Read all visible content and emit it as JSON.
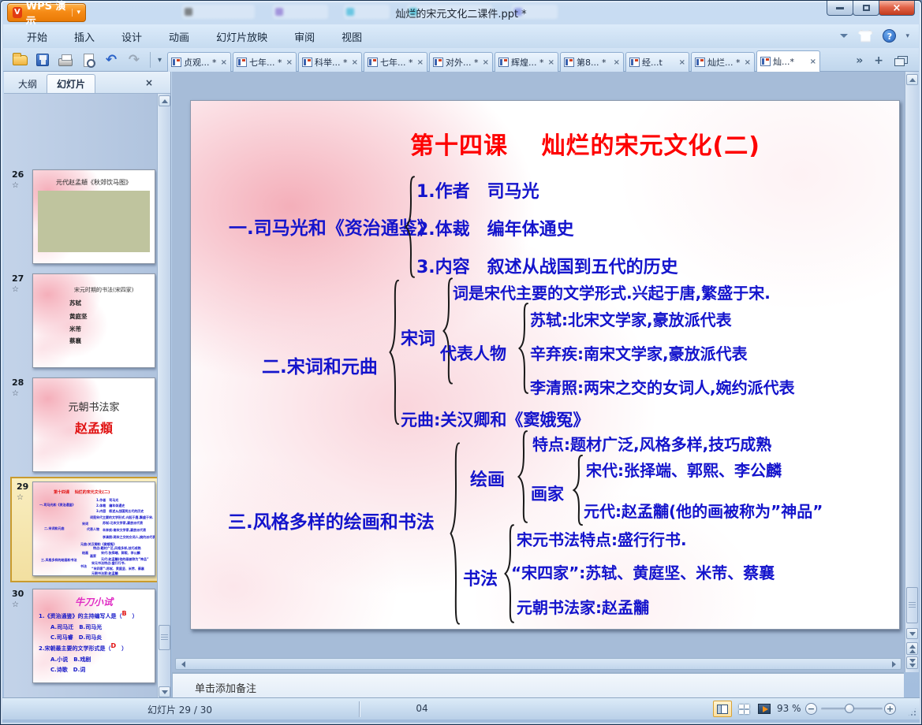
{
  "window": {
    "app_button_label": "WPS 演示",
    "title": "灿烂的宋元文化二课件.ppt *"
  },
  "menu": {
    "items": [
      "开始",
      "插入",
      "设计",
      "动画",
      "幻灯片放映",
      "审阅",
      "视图"
    ]
  },
  "glyphs": {
    "undo": "↶",
    "redo": "↷",
    "caret": "▾",
    "tabs_left": "«",
    "tabs_right": "»",
    "plus": "+",
    "close": "×",
    "star": "☆",
    "minus": "−",
    "plus_zoom": "+",
    "question": "?",
    "wps_logo": "V"
  },
  "doc_tabs": [
    {
      "label": "贞观... *"
    },
    {
      "label": "七年... *"
    },
    {
      "label": "科举... *"
    },
    {
      "label": "七年... *"
    },
    {
      "label": "对外... *"
    },
    {
      "label": "辉煌... *"
    },
    {
      "label": "第8... *"
    },
    {
      "label": "经...t"
    },
    {
      "label": "灿烂... *"
    },
    {
      "label": "灿...*"
    }
  ],
  "sidebar": {
    "outline_tab": "大纲",
    "slides_tab": "幻灯片",
    "slides": [
      {
        "number": "26",
        "caption": "元代赵孟頫《秋郊饮马图》"
      },
      {
        "number": "27",
        "title": "宋元时期的书法(宋四家)",
        "items": [
          "苏轼",
          "黄庭坚",
          "米芾",
          "蔡襄"
        ]
      },
      {
        "number": "28",
        "line1": "元朝书法家",
        "line2": "赵孟頫"
      },
      {
        "number": "29"
      },
      {
        "number": "30",
        "title": "牛刀小试",
        "q1_pre": "1.《资治通鉴》的主持编写人是（",
        "q1_ans": "B",
        "q1_post": "　）",
        "q1_opts_a": "A.司马迁　B.司马光",
        "q1_opts_b": "C.司马睿　D.司马炎",
        "q2_pre": "2.宋朝最主要的文学形式是（",
        "q2_ans": "D",
        "q2_post": "　）",
        "q2_opts_a": "A.小说　B.戏剧",
        "q2_opts_b": "C.诗歌　D.词"
      }
    ]
  },
  "slide": {
    "title": "第十四课　 灿烂的宋元文化(二)",
    "s1_label": "一.司马光和《资治通鉴》",
    "s1_items": [
      "1.作者　司马光",
      "2.体裁　编年体通史",
      "3.内容　叙述从战国到五代的历史"
    ],
    "s2_label": "二.宋词和元曲",
    "songci": "宋词",
    "ci_line": "词是宋代主要的文学形式.兴起于唐,繁盛于宋.",
    "daibiao": "代表人物",
    "reps": [
      "苏轼:北宋文学家,豪放派代表",
      "辛弃疾:南宋文学家,豪放派代表",
      "李清照:两宋之交的女词人,婉约派代表"
    ],
    "yuanqu": "元曲:关汉卿和《窦娥冤》",
    "s3_label": "三.风格多样的绘画和书法",
    "huihua": "绘画",
    "tedian": "特点:题材广泛,风格多样,技巧成熟",
    "huajia": "画家",
    "songdai": "宋代:张择端、郭熙、李公麟",
    "yuandai": "元代:赵孟黼(他的画被称为”神品”",
    "shufa": "书法",
    "shufa_items": [
      "宋元书法特点:盛行行书.",
      "“宋四家”:苏轼、黄庭坚、米芾、蔡襄",
      "元朝书法家:赵孟黼"
    ]
  },
  "notes": {
    "placeholder": "单击添加备注"
  },
  "statusbar": {
    "slide_info": "幻灯片 29 / 30",
    "section_label": "04",
    "zoom_level": "93 %"
  },
  "colors": {
    "title_red": "#fe0000",
    "body_blue": "#1414cc",
    "wps_orange": "#f28a1e",
    "active_slide_border": "#c99b2e"
  }
}
